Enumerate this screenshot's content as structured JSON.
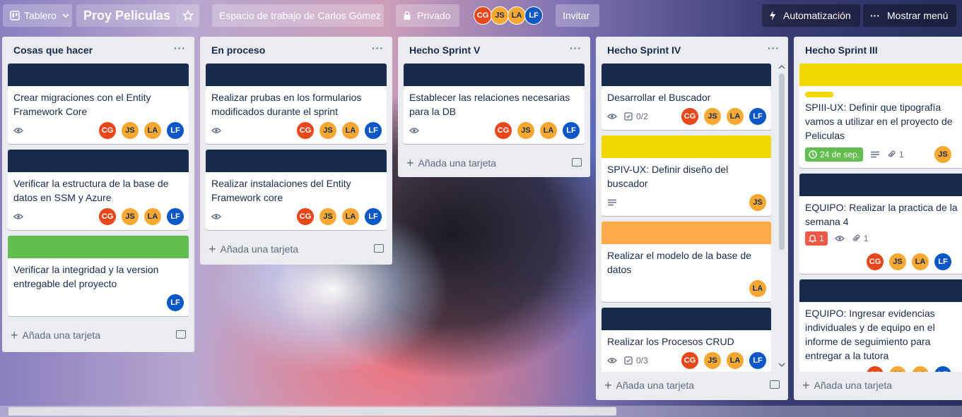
{
  "header": {
    "board_switcher": "Tablero",
    "board_title": "Proy Peliculas",
    "workspace": "Espacio de trabajo de Carlos Gómez",
    "visibility": "Privado",
    "members": [
      "CG",
      "JS",
      "LA",
      "LF"
    ],
    "invite": "Invitar",
    "automation": "Automatización",
    "menu": "Mostrar menú"
  },
  "add_card_label": "Añada una tarjeta",
  "lists": [
    {
      "title": "Cosas que hacer",
      "cards": [
        {
          "cover": "#172b4d",
          "title": "Crear migraciones con el Entity Framework Core",
          "members": [
            "CG",
            "JS",
            "LA",
            "LF"
          ]
        },
        {
          "cover": "#172b4d",
          "title": "Verificar la estructura de la base de datos en SSM y Azure",
          "members": [
            "CG",
            "JS",
            "LA",
            "LF"
          ]
        },
        {
          "cover": "#61bd4f",
          "title": "Verificar la integridad y la version entregable del proyecto",
          "members": [
            "LF"
          ]
        }
      ]
    },
    {
      "title": "En proceso",
      "cards": [
        {
          "cover": "#172b4d",
          "title": "Realizar prubas en los formularios modificados durante el sprint",
          "members": [
            "CG",
            "JS",
            "LA",
            "LF"
          ]
        },
        {
          "cover": "#172b4d",
          "title": "Realizar instalaciones del Entity Framework core",
          "members": [
            "CG",
            "JS",
            "LA",
            "LF"
          ]
        }
      ]
    },
    {
      "title": "Hecho Sprint V",
      "cards": [
        {
          "cover": "#172b4d",
          "title": "Establecer las relaciones necesarias para la DB",
          "members": [
            "CG",
            "JS",
            "LA",
            "LF"
          ]
        }
      ]
    },
    {
      "title": "Hecho Sprint IV",
      "cards": [
        {
          "cover": "#172b4d",
          "title": "Desarrollar el Buscador",
          "checklist": "0/2",
          "members": [
            "CG",
            "JS",
            "LA",
            "LF"
          ]
        },
        {
          "cover": "#f2d600",
          "title": "SPIV-UX: Definir diseño del buscador",
          "members": [
            "JS"
          ]
        },
        {
          "cover": "#ffab4a",
          "title": "Realizar el modelo de la base de datos",
          "members": [
            "LA"
          ]
        },
        {
          "cover": "#172b4d",
          "title": "Realizar los Procesos CRUD",
          "checklist": "0/3",
          "members": [
            "CG",
            "JS",
            "LA",
            "LF"
          ]
        }
      ]
    },
    {
      "title": "Hecho Sprint III",
      "cards": [
        {
          "cover": "#f2d600",
          "title": "SPIII-UX: Definir que tipografía vamos a utilizar en el proyecto de Peliculas",
          "due": "24 de sep.",
          "attachments": "1",
          "members": [
            "JS"
          ]
        },
        {
          "cover": "#172b4d",
          "title": "EQUIPO: Realizar la practica de la semana 4",
          "notifications": "1",
          "attachments": "1",
          "members": [
            "CG",
            "JS",
            "LA",
            "LF"
          ]
        },
        {
          "cover": "#172b4d",
          "title": "EQUIPO: Ingresar evidencias individuales y de equipo en el informe de seguimiento para entregar a la tutora",
          "members": [
            "CG",
            "JS",
            "LA",
            "LF"
          ]
        }
      ]
    }
  ],
  "icons": [
    "board-icon",
    "chevron-down-icon",
    "star-icon",
    "lock-icon",
    "bolt-icon",
    "more-icon",
    "eye-icon",
    "checklist-icon",
    "description-icon",
    "attachment-icon",
    "clock-icon",
    "bell-icon",
    "plus-icon",
    "template-icon"
  ],
  "colors": {
    "list_bg": "#ebecf0",
    "cover_dark": "#172b4d",
    "green": "#61bd4f",
    "yellow": "#f2d600",
    "orange": "#ffab4a",
    "red": "#eb5a46"
  }
}
